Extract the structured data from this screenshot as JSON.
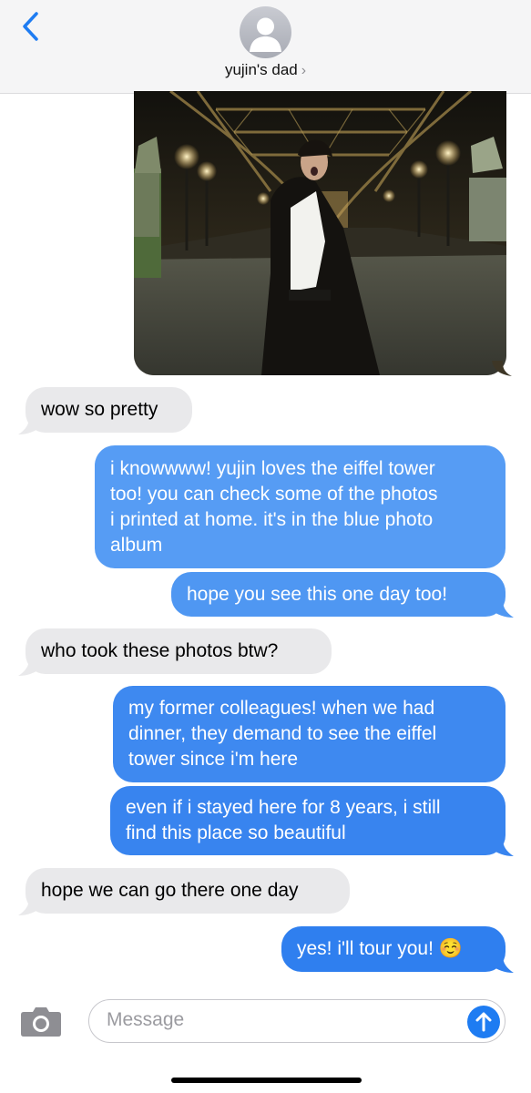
{
  "header": {
    "contact_name": "yujin's dad",
    "chevron": "›"
  },
  "messages": [
    {
      "direction": "in",
      "lines": [
        "wow so pretty"
      ]
    },
    {
      "direction": "out",
      "lines": [
        "i knowwww! yujin loves the eiffel tower",
        "too! you can check some of the photos",
        "i printed at home. it's in the blue photo",
        "album"
      ]
    },
    {
      "direction": "out",
      "lines": [
        "hope you see this one day too!"
      ]
    },
    {
      "direction": "in",
      "lines": [
        "who took these photos btw?"
      ]
    },
    {
      "direction": "out",
      "lines": [
        "my former colleagues! when we had",
        "dinner, they demand to see the eiffel",
        "tower since i'm here"
      ]
    },
    {
      "direction": "out",
      "lines": [
        "even if i stayed here for 8 years, i still",
        "find this place so beautiful"
      ]
    },
    {
      "direction": "in",
      "lines": [
        "hope we can go there one day"
      ]
    },
    {
      "direction": "out",
      "lines": [
        "yes! i'll tour you! ☺️"
      ]
    }
  ],
  "composer": {
    "placeholder": "Message"
  },
  "icons": {
    "back": "chevron-left-icon",
    "avatar": "person-silhouette-icon",
    "camera": "camera-icon",
    "send": "arrow-up-icon"
  },
  "colors": {
    "incoming_bubble": "#e9e9eb",
    "outgoing_bubble": "#3b86ef",
    "outgoing_bubble_light": "#5aa0f5",
    "accent": "#1e7cf2"
  }
}
